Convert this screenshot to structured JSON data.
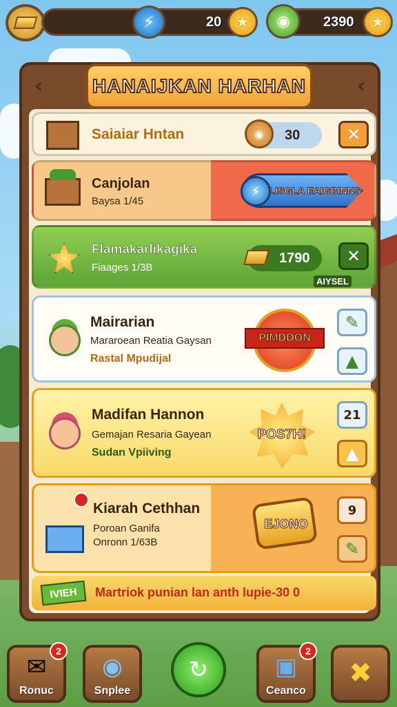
{
  "topbar": {
    "energy_value": "20",
    "gems_value": "2390"
  },
  "panel": {
    "title": "HANAIJKAN HARHAN"
  },
  "rows": [
    {
      "title": "Saiaiar Hntan",
      "value": "30"
    },
    {
      "title": "Canjolan",
      "sub": "Baysa 1/45",
      "button": "LISGLA EAIGBINNS"
    },
    {
      "title": "Flamakarlikagika",
      "sub": "Fiaages 1/3B",
      "value": "1790",
      "tag": "AIYSEL"
    },
    {
      "title": "Mairarian",
      "sub": "Mararoean Reatia Gaysan",
      "sub2": "Rastal Mpudijal",
      "badge": "PIMDDON"
    },
    {
      "title": "Madifan Hannon",
      "sub": "Gemajan Resaria Gayean",
      "sub2": "Sudan Vpiiving",
      "badge": "POS7H!",
      "count": "21"
    },
    {
      "title": "Kiarah Cethhan",
      "sub": "Poroan Ganifa",
      "sub2": "Onronn 1/63B",
      "badge": "EJONO",
      "count": "9"
    }
  ],
  "footer": {
    "tag": "IVIEH",
    "text": "Martriok punian lan anth lupie-30 0"
  },
  "bottom_nav": [
    {
      "label": "Ronuc",
      "badge": "2"
    },
    {
      "label": "Snplee"
    },
    {
      "label": ""
    },
    {
      "label": "Ceanco",
      "badge": "2"
    },
    {
      "label": ""
    }
  ]
}
